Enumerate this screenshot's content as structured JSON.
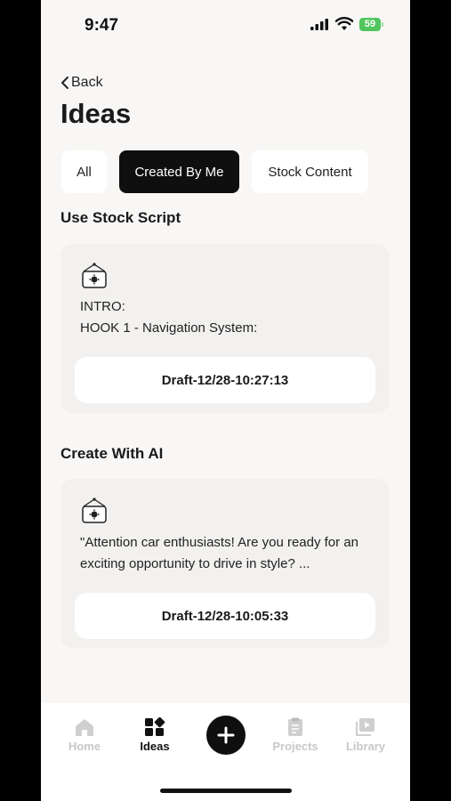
{
  "status": {
    "time": "9:47",
    "battery": "59"
  },
  "header": {
    "back_label": "Back",
    "title": "Ideas"
  },
  "tabs": [
    {
      "label": "All",
      "active": false
    },
    {
      "label": "Created By Me",
      "active": true
    },
    {
      "label": "Stock Content",
      "active": false
    }
  ],
  "sections": {
    "stock": {
      "heading": "Use Stock Script",
      "lines": [
        "INTRO:",
        "HOOK 1 - Navigation System:"
      ],
      "draft": "Draft-12/28-10:27:13"
    },
    "ai": {
      "heading": "Create With AI",
      "text": "\"Attention car enthusiasts! Are you ready for an exciting opportunity to drive in style? ...",
      "draft": "Draft-12/28-10:05:33"
    }
  },
  "nav": {
    "home": "Home",
    "ideas": "Ideas",
    "projects": "Projects",
    "library": "Library"
  },
  "colors": {
    "active_tab": "#0f0f0f",
    "battery": "#52c65e",
    "background": "#f8f7f6"
  }
}
